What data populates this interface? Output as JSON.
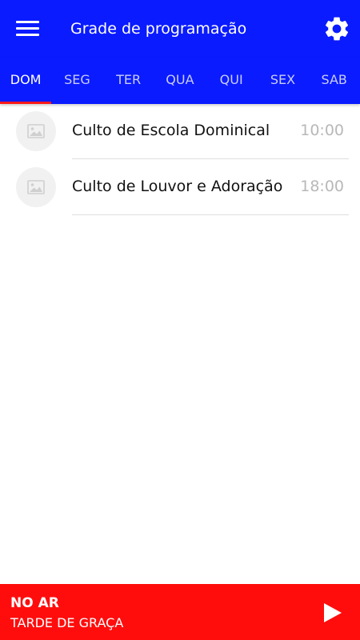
{
  "header": {
    "title": "Grade de programação",
    "menu_icon": "hamburger-menu-icon",
    "settings_icon": "gear-icon",
    "background_color": "#0a1bff"
  },
  "tabs": {
    "items": [
      {
        "label": "DOM",
        "active": true
      },
      {
        "label": "SEG",
        "active": false
      },
      {
        "label": "TER",
        "active": false
      },
      {
        "label": "QUA",
        "active": false
      },
      {
        "label": "QUI",
        "active": false
      },
      {
        "label": "SEX",
        "active": false
      },
      {
        "label": "SAB",
        "active": false
      }
    ],
    "indicator_color": "#ff1a1a"
  },
  "schedule": {
    "items": [
      {
        "title": "Culto de Escola Dominical",
        "time": "10:00",
        "icon": "image-placeholder-icon"
      },
      {
        "title": "Culto de Louvor e Adoração",
        "time": "18:00",
        "icon": "image-placeholder-icon"
      }
    ]
  },
  "player": {
    "status": "NO AR",
    "program": "TARDE DE GRAÇA",
    "play_icon": "play-icon",
    "background_color": "#ff0d0d"
  }
}
